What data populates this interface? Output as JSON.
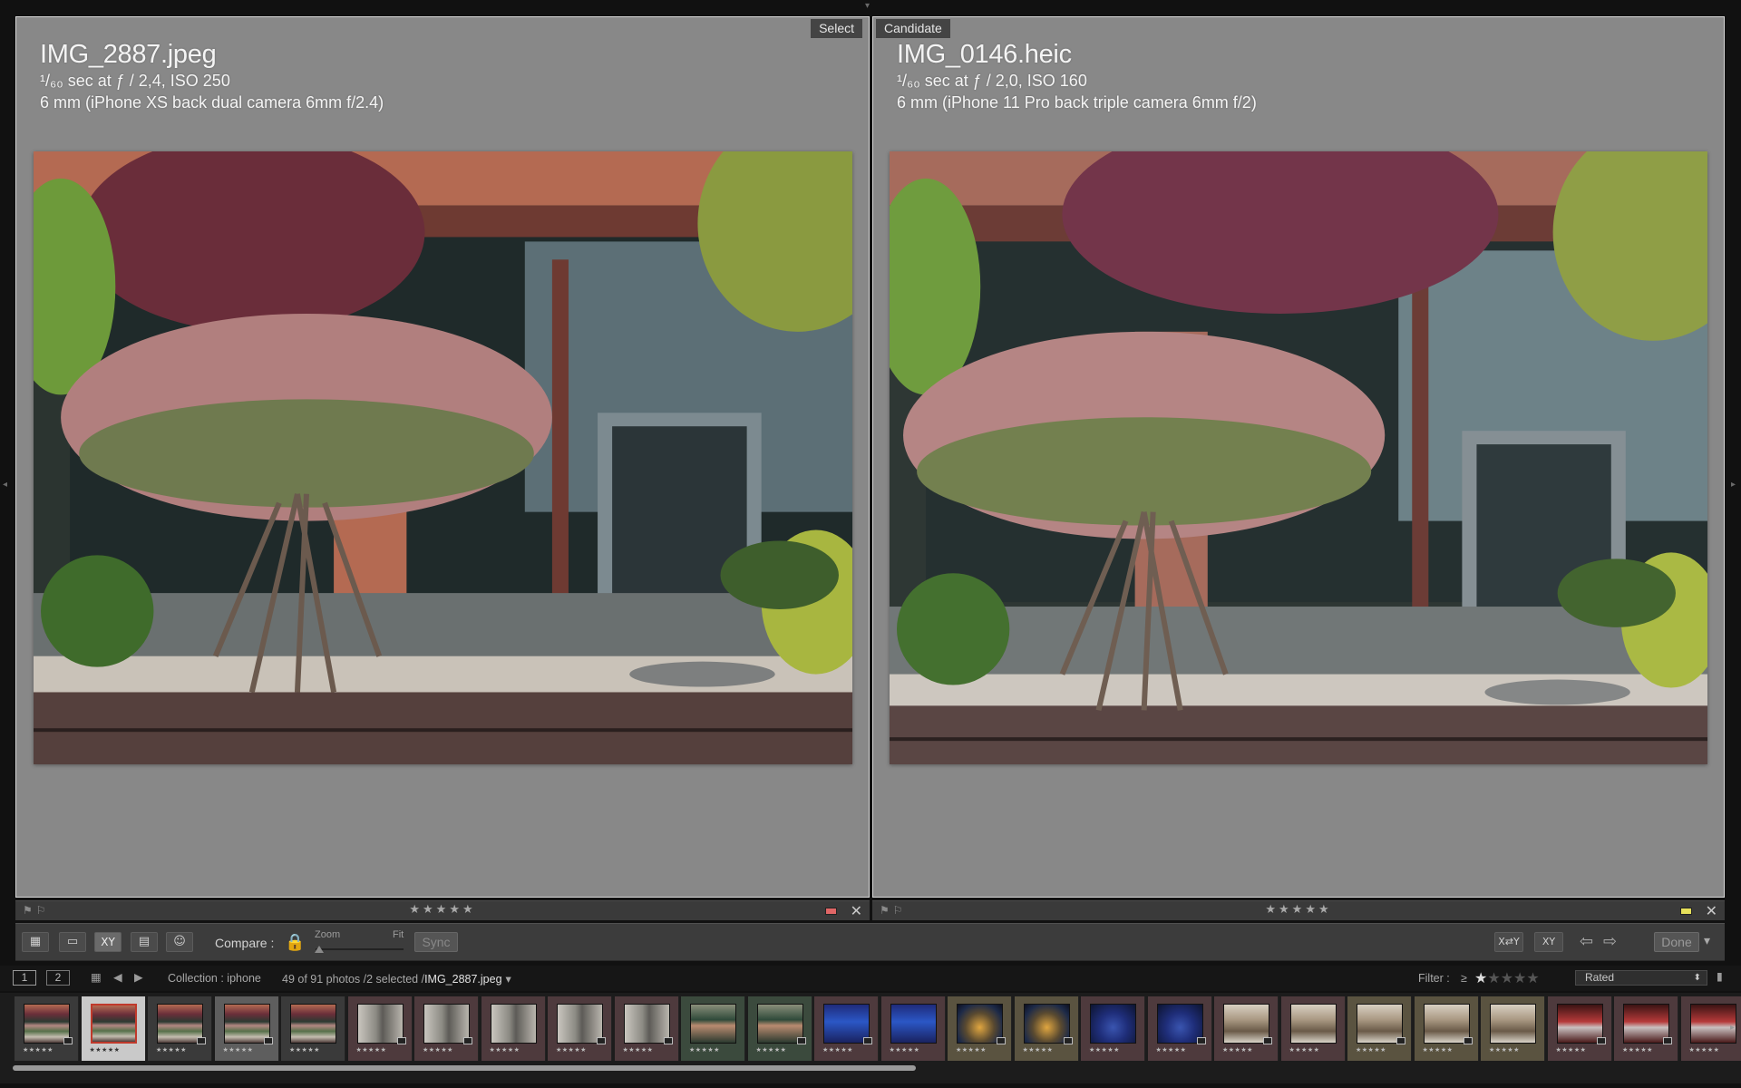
{
  "compare": {
    "left": {
      "tag": "Select",
      "filename": "IMG_2887.jpeg",
      "exposure": "¹/₆₀ sec at ƒ / 2,4, ISO 250",
      "lens": "6 mm (iPhone XS back dual camera 6mm f/2.4)",
      "rating_stars": "★★★★★",
      "color_label": "#e06666"
    },
    "right": {
      "tag": "Candidate",
      "filename": "IMG_0146.heic",
      "exposure": "¹/₆₀ sec at ƒ / 2,0, ISO 160",
      "lens": "6 mm (iPhone 11 Pro back triple camera 6mm f/2)",
      "rating_stars": "★★★★★",
      "color_label": "#e6e05a"
    }
  },
  "toolbar": {
    "compare_label": "Compare :",
    "zoom_label": "Zoom",
    "fit_label": "Fit",
    "sync_label": "Sync",
    "done_label": "Done",
    "survey_icon": "XY",
    "swap_icon": "X⇄Y"
  },
  "filmstrip_header": {
    "monitor_1": "1",
    "monitor_2": "2",
    "source": "Collection : iphone",
    "count": "49 of 91 photos /2 selected /",
    "current_file": "IMG_2887.jpeg",
    "filter_label": "Filter :",
    "filter_op": "≥",
    "filter_stars": "★",
    "filter_stars_off": "★★★★",
    "filter_preset": "Rated"
  },
  "filmstrip": {
    "star_text": "★★★★★",
    "thumbs": [
      {
        "type": "garden",
        "state": "normal"
      },
      {
        "type": "garden",
        "state": "primary"
      },
      {
        "type": "garden",
        "state": "normal"
      },
      {
        "type": "garden",
        "state": "selected"
      },
      {
        "type": "garden",
        "state": "normal"
      },
      {
        "type": "corridor",
        "state": "tint-red"
      },
      {
        "type": "corridor",
        "state": "tint-red"
      },
      {
        "type": "corridor",
        "state": "tint-red"
      },
      {
        "type": "corridor",
        "state": "tint-red"
      },
      {
        "type": "corridor",
        "state": "tint-red"
      },
      {
        "type": "portrait",
        "state": "tint-grn"
      },
      {
        "type": "portrait",
        "state": "tint-grn"
      },
      {
        "type": "blue",
        "state": "tint-red"
      },
      {
        "type": "blue",
        "state": "tint-red"
      },
      {
        "type": "arch",
        "state": "tint-gold"
      },
      {
        "type": "arch",
        "state": "tint-gold"
      },
      {
        "type": "archblue",
        "state": "tint-red"
      },
      {
        "type": "archblue",
        "state": "tint-red"
      },
      {
        "type": "room",
        "state": "tint-red"
      },
      {
        "type": "room",
        "state": "tint-red"
      },
      {
        "type": "room",
        "state": "tint-gold"
      },
      {
        "type": "room",
        "state": "tint-gold"
      },
      {
        "type": "room",
        "state": "tint-gold"
      },
      {
        "type": "hall",
        "state": "tint-red"
      },
      {
        "type": "hall",
        "state": "tint-red"
      },
      {
        "type": "hall",
        "state": "tint-red"
      }
    ]
  }
}
